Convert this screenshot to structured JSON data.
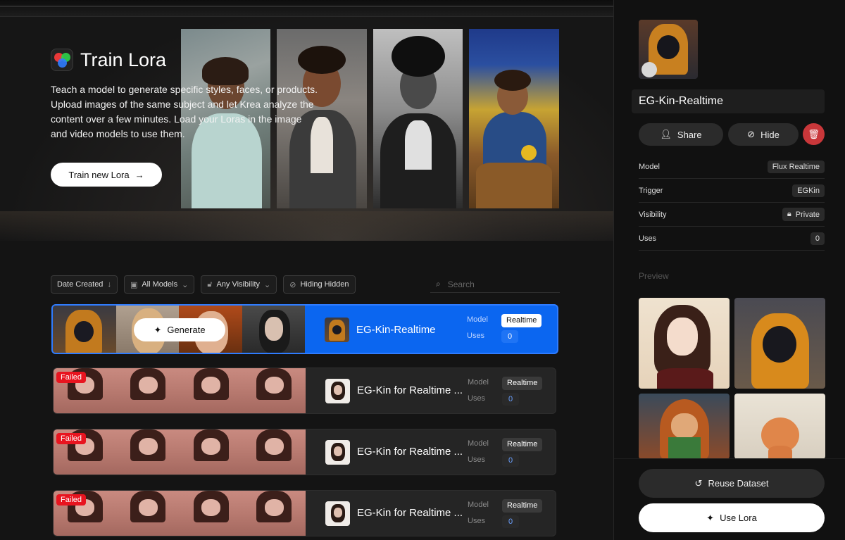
{
  "hero": {
    "title": "Train Lora",
    "description": "Teach a model to generate specific styles, faces, or products. Upload images of the same subject and let Krea analyze the content over a few minutes. Load your Loras in the image and video models to use them.",
    "train_button": "Train new Lora"
  },
  "filters": {
    "date": "Date Created",
    "models": "All Models",
    "visibility": "Any Visibility",
    "hidden": "Hiding Hidden",
    "search_placeholder": "Search"
  },
  "rows": [
    {
      "name": "EG-Kin-Realtime",
      "model_label": "Model",
      "model": "Realtime",
      "uses_label": "Uses",
      "uses": "0",
      "generate": "Generate",
      "status": ""
    },
    {
      "name": "EG-Kin for Realtime ...",
      "model_label": "Model",
      "model": "Realtime",
      "uses_label": "Uses",
      "uses": "0",
      "status": "Failed"
    },
    {
      "name": "EG-Kin for Realtime ...",
      "model_label": "Model",
      "model": "Realtime",
      "uses_label": "Uses",
      "uses": "0",
      "status": "Failed"
    },
    {
      "name": "EG-Kin for Realtime ...",
      "model_label": "Model",
      "model": "Realtime",
      "uses_label": "Uses",
      "uses": "0",
      "status": "Failed"
    }
  ],
  "panel": {
    "title": "EG-Kin-Realtime",
    "share": "Share",
    "hide": "Hide",
    "props": [
      {
        "label": "Model",
        "value": "Flux Realtime"
      },
      {
        "label": "Trigger",
        "value": "EGKin"
      },
      {
        "label": "Visibility",
        "value": "Private"
      },
      {
        "label": "Uses",
        "value": "0"
      }
    ],
    "preview_label": "Preview",
    "reuse": "Reuse Dataset",
    "use": "Use Lora"
  },
  "colors": {
    "accent": "#0b66f0",
    "danger": "#c9373a",
    "failed": "#e8141f"
  }
}
